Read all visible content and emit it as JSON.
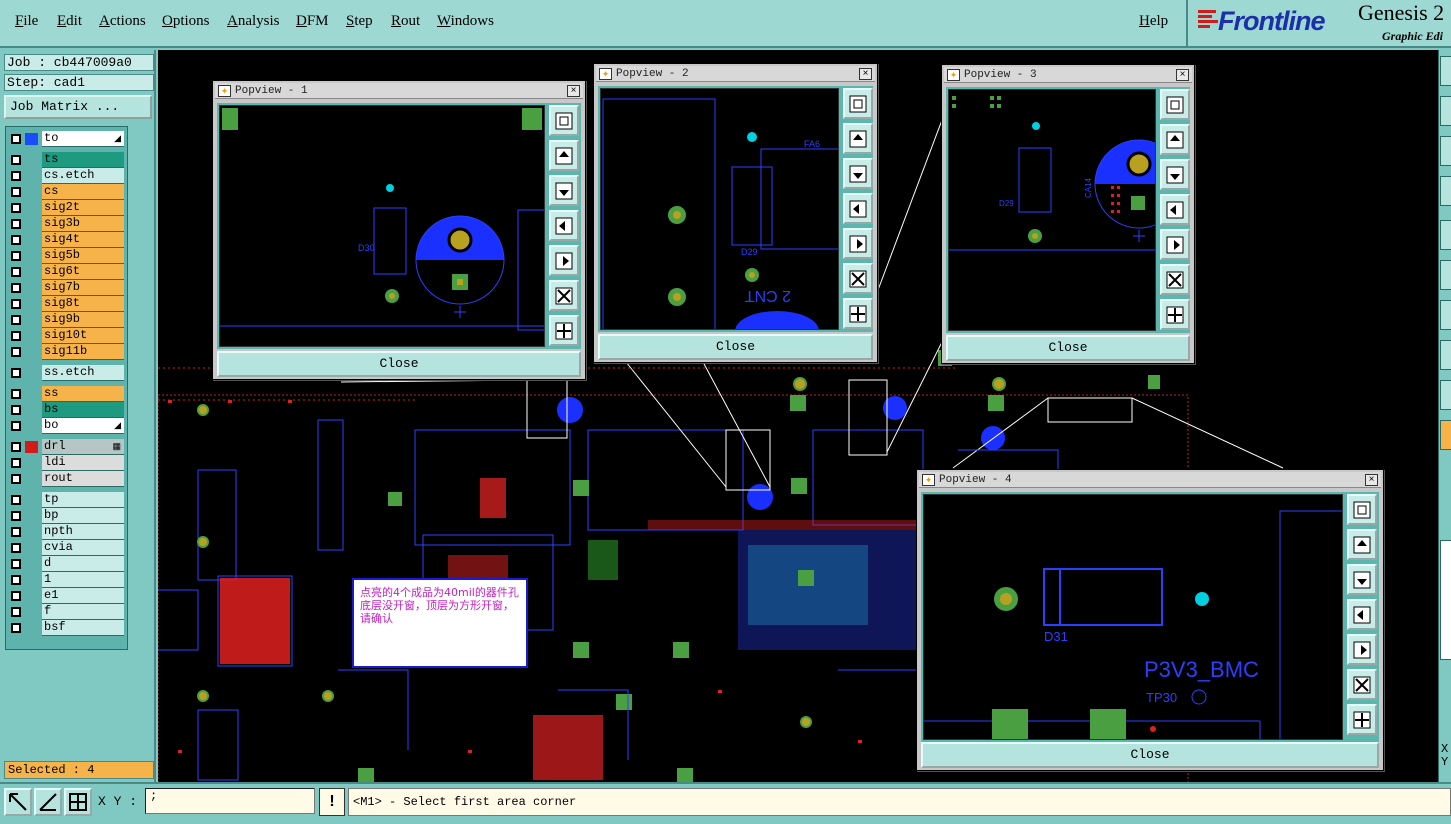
{
  "menubar": {
    "items": [
      "File",
      "Edit",
      "Actions",
      "Options",
      "Analysis",
      "DFM",
      "Step",
      "Rout",
      "Windows"
    ],
    "help": "Help"
  },
  "brand": {
    "logo_text": "Frontline",
    "product": "Genesis 2",
    "subtitle": "Graphic Edi",
    "accent_color": "#d41b1b",
    "logo_color": "#1b2fa8"
  },
  "job": {
    "job_label": "Job : cb447009a0",
    "step_label": "Step: cad1",
    "job_matrix": "Job Matrix ..."
  },
  "layers": [
    {
      "name": "to",
      "color": "#ffffff",
      "swatch": "#1a4cff",
      "mark": "◢"
    },
    {
      "name": "ts",
      "color": "#1d9a80"
    },
    {
      "name": "cs.etch",
      "color": "#c9ece8"
    },
    {
      "name": "cs",
      "color": "#f6b34a"
    },
    {
      "name": "sig2t",
      "color": "#f6b34a"
    },
    {
      "name": "sig3b",
      "color": "#f6b34a"
    },
    {
      "name": "sig4t",
      "color": "#f6b34a"
    },
    {
      "name": "sig5b",
      "color": "#f6b34a"
    },
    {
      "name": "sig6t",
      "color": "#f6b34a"
    },
    {
      "name": "sig7b",
      "color": "#f6b34a"
    },
    {
      "name": "sig8t",
      "color": "#f6b34a"
    },
    {
      "name": "sig9b",
      "color": "#f6b34a"
    },
    {
      "name": "sig10t",
      "color": "#f6b34a"
    },
    {
      "name": "sig11b",
      "color": "#f6b34a"
    },
    {
      "name": "ss.etch",
      "color": "#c9ece8"
    },
    {
      "name": "ss",
      "color": "#f6b34a"
    },
    {
      "name": "bs",
      "color": "#1d9a80"
    },
    {
      "name": "bo",
      "color": "#ffffff",
      "mark": "◢"
    },
    {
      "name": "drl",
      "color": "#b5c6c4",
      "swatch": "#d41b1b",
      "mark": "▦"
    },
    {
      "name": "ldi",
      "color": "#dcdcdc"
    },
    {
      "name": "rout",
      "color": "#dcdcdc"
    },
    {
      "name": "tp",
      "color": "#c9ece8"
    },
    {
      "name": "bp",
      "color": "#c9ece8"
    },
    {
      "name": "npth",
      "color": "#c9ece8"
    },
    {
      "name": "cvia",
      "color": "#c9ece8"
    },
    {
      "name": "d",
      "color": "#c9ece8"
    },
    {
      "name": "1",
      "color": "#c9ece8"
    },
    {
      "name": "e1",
      "color": "#c9ece8"
    },
    {
      "name": "f",
      "color": "#c9ece8"
    },
    {
      "name": "bsf",
      "color": "#c9ece8"
    }
  ],
  "selected": "Selected : 4",
  "popviews": [
    {
      "title": "Popview - 1",
      "close": "Close",
      "refdes": "D30"
    },
    {
      "title": "Popview - 2",
      "close": "Close",
      "refdes": "D29",
      "refdes2": "FA6",
      "mirror_text": "2 CNT"
    },
    {
      "title": "Popview - 3",
      "close": "Close",
      "refdes": "D29",
      "refdes2": "CA14"
    },
    {
      "title": "Popview - 4",
      "close": "Close",
      "refdes": "D31",
      "net": "P3V3_BMC",
      "testpoint": "TP30"
    }
  ],
  "annotation": "点亮的4个成品为40mil的器件孔底层没开窗，顶层为方形开窗，请确认",
  "status": {
    "xy_label": "X Y :",
    "xy_value": ";",
    "warn": "!",
    "message": "<M1> - Select first area corner",
    "right_xy": "X\nY"
  }
}
